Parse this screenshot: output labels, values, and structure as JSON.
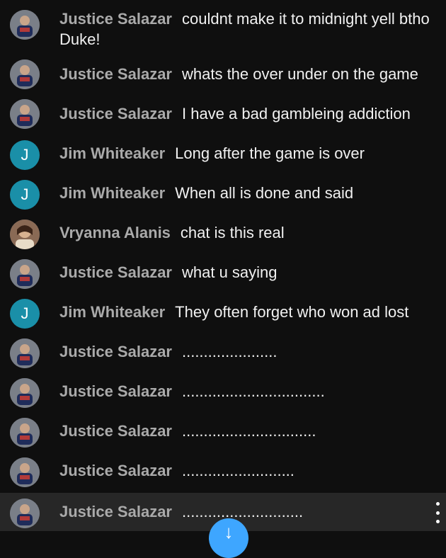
{
  "messages": [
    {
      "author": "Justice Salazar",
      "text": "couldnt make it to midnight yell btho Duke!",
      "avatar": "photo"
    },
    {
      "author": "Justice Salazar",
      "text": "whats the over under on the game",
      "avatar": "photo"
    },
    {
      "author": "Justice Salazar",
      "text": "I have a bad gambleing addiction",
      "avatar": "photo"
    },
    {
      "author": "Jim Whiteaker",
      "text": "Long after the game is over",
      "avatar": "letter",
      "initial": "J"
    },
    {
      "author": "Jim Whiteaker",
      "text": "When all is done and said",
      "avatar": "letter",
      "initial": "J"
    },
    {
      "author": "Vryanna Alanis",
      "text": "chat is this real",
      "avatar": "photo2"
    },
    {
      "author": "Justice Salazar",
      "text": "what u saying",
      "avatar": "photo"
    },
    {
      "author": "Jim Whiteaker",
      "text": "They often forget who won ad lost",
      "avatar": "letter",
      "initial": "J"
    },
    {
      "author": "Justice Salazar",
      "text": "......................",
      "avatar": "photo"
    },
    {
      "author": "Justice Salazar",
      "text": ".................................",
      "avatar": "photo"
    },
    {
      "author": "Justice Salazar",
      "text": "...............................",
      "avatar": "photo"
    },
    {
      "author": "Justice Salazar",
      "text": "..........................",
      "avatar": "photo"
    },
    {
      "author": "Justice Salazar",
      "text": "............................",
      "avatar": "photo"
    }
  ],
  "icons": {
    "more": "more-vert-icon",
    "scroll_down": "arrow-down-icon"
  },
  "colors": {
    "background": "#0f0f0f",
    "selected_row": "#272727",
    "author": "#aaaaaa",
    "letter_avatar": "#1a8fa8",
    "fab": "#3ea6ff"
  }
}
